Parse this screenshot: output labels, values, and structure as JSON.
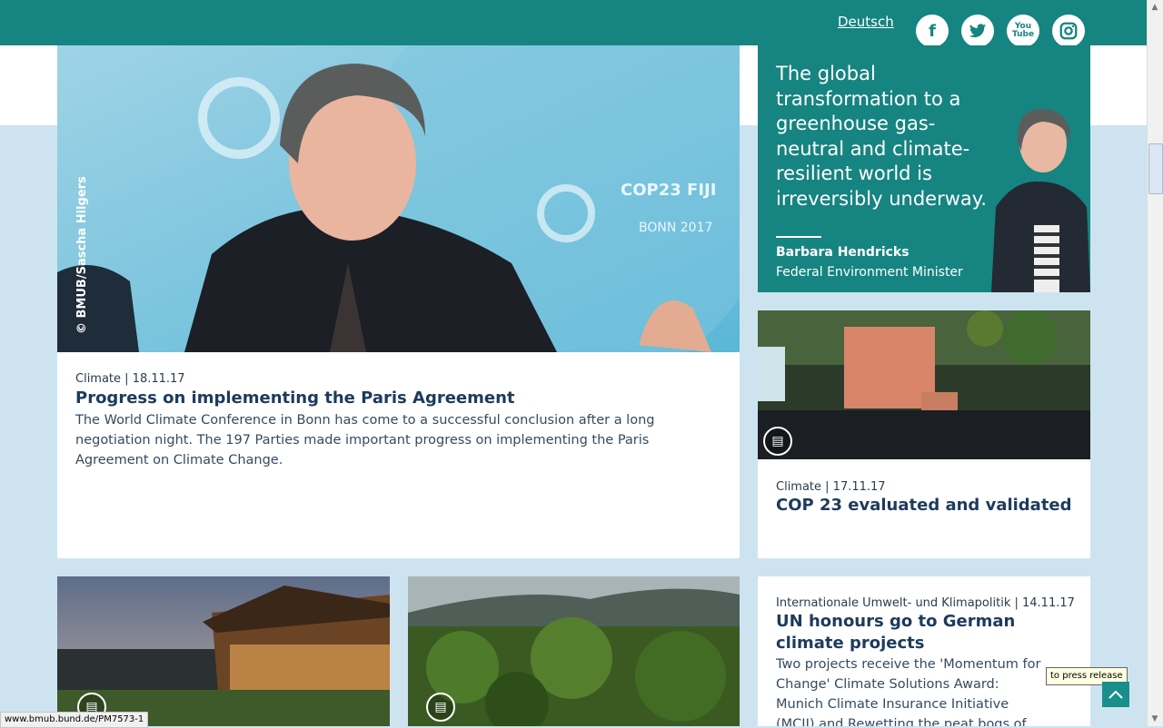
{
  "header": {
    "language_link": "Deutsch",
    "social": [
      {
        "name": "facebook-icon",
        "glyph": "f"
      },
      {
        "name": "twitter-icon",
        "glyph": "t"
      },
      {
        "name": "youtube-icon",
        "glyph": "You Tube"
      },
      {
        "name": "instagram-icon",
        "glyph": "◎"
      }
    ]
  },
  "main_article": {
    "photo_credit": "© BMUB/Sascha Hilgers",
    "meta": "Climate | 18.11.17",
    "title": "Progress on implementing the Paris Agreement",
    "teaser": "The World Climate Conference in Bonn has come to a successful conclusion after a long negotiation night. The 197 Parties made important progress on implementing the Paris Agreement on Climate Change."
  },
  "quote": {
    "text": "The global transformation to a greenhouse gas-neutral and climate-resilient world is irreversibly underway.",
    "name": "Barbara Hendricks",
    "role": "Federal Environment Minister"
  },
  "cop23_article": {
    "meta": "Climate | 17.11.17",
    "title": "COP 23 evaluated and validated"
  },
  "un_article": {
    "meta": "Internationale Umwelt- und Klimapolitik | 14.11.17",
    "title": "UN honours go to German climate projects",
    "teaser": "Two projects receive the 'Momentum for Change' Climate Solutions Award: Munich Climate Insurance Initiative (MCII) and Rewetting the peat bogs of Russia"
  },
  "tooltip": "to press release",
  "status_url": "www.bmub.bund.de/PM7573-1",
  "colors": {
    "teal": "#168480",
    "page_bg": "#cde4f0",
    "headline": "#1d3b5c"
  }
}
